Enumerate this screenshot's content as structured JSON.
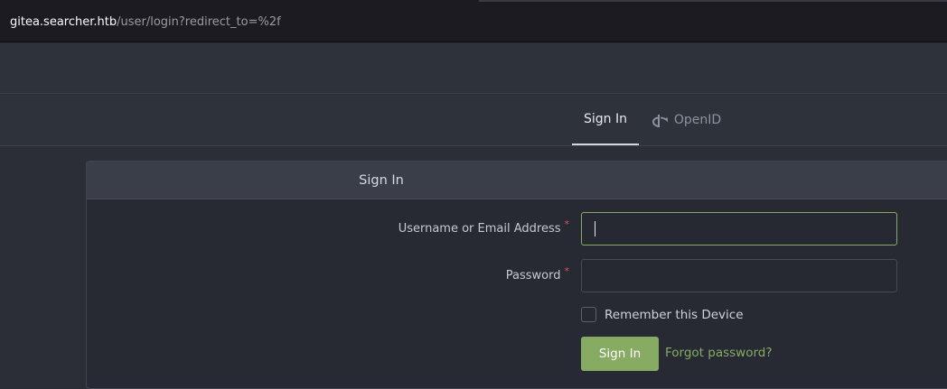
{
  "browser": {
    "url_host": "gitea.searcher.htb",
    "url_path": "/user/login?redirect_to=%2f"
  },
  "tabs": {
    "signin_label": "Sign In",
    "openid_label": "OpenID"
  },
  "form": {
    "header_title": "Sign In",
    "username_label": "Username or Email Address",
    "password_label": "Password",
    "required_mark": "*",
    "username_value": "",
    "password_value": "",
    "remember_label": "Remember this Device",
    "remember_checked": false,
    "submit_label": "Sign In",
    "forgot_label": "Forgot password?"
  },
  "colors": {
    "accent": "#87ab63",
    "required": "#d9534f",
    "background": "#2b2e36"
  },
  "icons": {
    "openid": "openid-icon"
  }
}
